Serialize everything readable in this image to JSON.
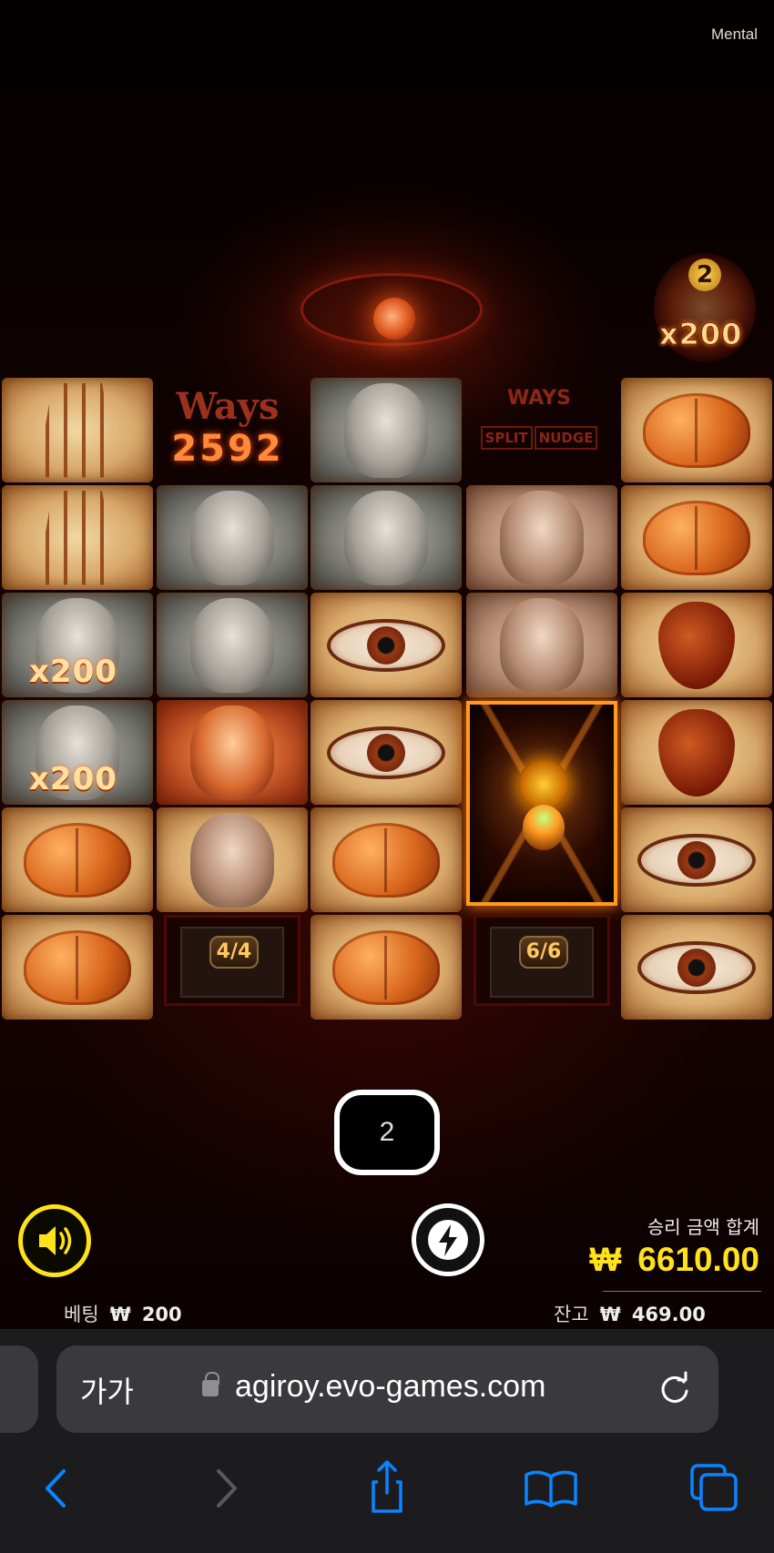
{
  "game": {
    "title": "Mental"
  },
  "multiplier_badge": {
    "count": "2",
    "multiplier": "x200"
  },
  "reels": {
    "ways_label": "Ways",
    "ways_count": "2592",
    "feature": {
      "top": "WAYS",
      "left": "SPLIT",
      "right": "NUDGE"
    },
    "cell_multiplier_1": "x200",
    "cell_multiplier_2": "x200",
    "counter_1": "4/4",
    "counter_2": "6/6"
  },
  "spins_remaining": "2",
  "win": {
    "label": "승리 금액 합계",
    "currency": "₩",
    "amount": "6610.00"
  },
  "bet": {
    "label": "베팅",
    "currency": "₩",
    "amount": "200"
  },
  "balance": {
    "label": "잔고",
    "currency": "₩",
    "amount": "469.00"
  },
  "browser": {
    "text_size": "가가",
    "url": "agiroy.evo-games.com"
  },
  "icons": [
    "sound-icon",
    "turbo-icon",
    "lock-icon",
    "reload-icon",
    "back-icon",
    "forward-icon",
    "share-icon",
    "bookmarks-icon",
    "tabs-icon"
  ]
}
